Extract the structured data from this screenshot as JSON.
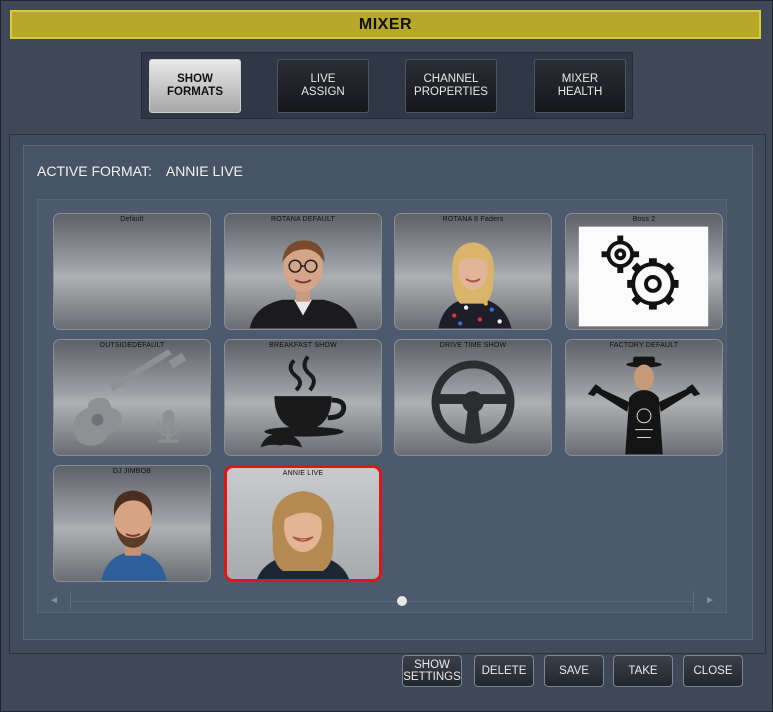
{
  "window": {
    "title": "MIXER"
  },
  "tabs": [
    {
      "label": "SHOW\nFORMATS",
      "active": true
    },
    {
      "label": "LIVE\nASSIGN",
      "active": false
    },
    {
      "label": "CHANNEL\nPROPERTIES",
      "active": false
    },
    {
      "label": "MIXER\nHEALTH",
      "active": false
    }
  ],
  "active_format": {
    "label": "ACTIVE FORMAT:",
    "value": "ANNIE LIVE"
  },
  "formats": [
    {
      "name": "Default",
      "icon": "none"
    },
    {
      "name": "ROTANA DEFAULT",
      "icon": "person-photo"
    },
    {
      "name": "ROTANA 8 Faders",
      "icon": "person-photo"
    },
    {
      "name": "Boss 2",
      "icon": "gears-icon"
    },
    {
      "name": "OUTSIDEDEFAULT",
      "icon": "guitar-microphone-icon"
    },
    {
      "name": "BREAKFAST SHOW",
      "icon": "coffee-cup-icon"
    },
    {
      "name": "DRIVE TIME SHOW",
      "icon": "steering-wheel-icon"
    },
    {
      "name": "FACTORY DEFAULT",
      "icon": "person-photo"
    },
    {
      "name": "DJ JIMBOB",
      "icon": "person-photo"
    },
    {
      "name": "ANNIE LIVE",
      "icon": "person-photo",
      "selected": true
    }
  ],
  "buttons": {
    "show_settings": "SHOW\nSETTINGS",
    "delete": "DELETE",
    "save": "SAVE",
    "take": "TAKE",
    "close": "CLOSE"
  },
  "scroll": {
    "left_arrow": "◄",
    "right_arrow": "►"
  },
  "colors": {
    "title_bar": "#b5a82a",
    "selected_border": "#e01616",
    "panel": "#475466"
  }
}
